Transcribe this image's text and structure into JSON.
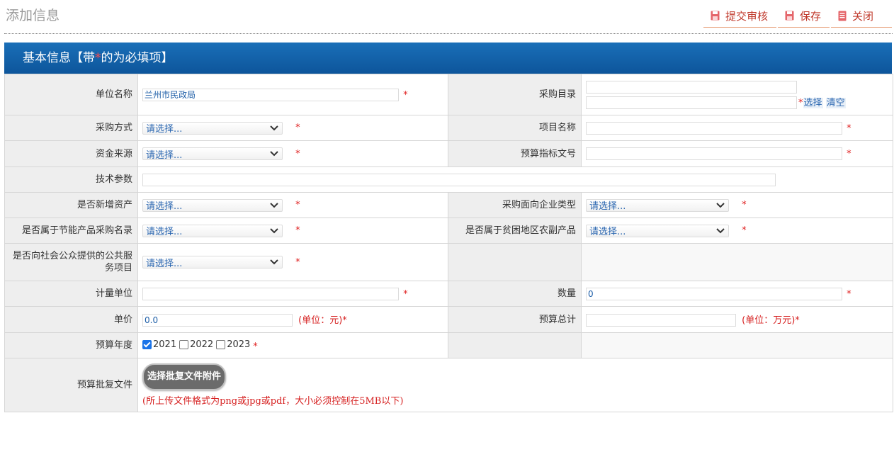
{
  "page": {
    "title": "添加信息"
  },
  "toolbar": {
    "submit_label": "提交审核",
    "save_label": "保存",
    "close_label": "关闭",
    "accent_color": "#c0392b"
  },
  "panel": {
    "title_prefix": "基本信息【带",
    "required_mark": "*",
    "title_suffix": "的为必填项】"
  },
  "form": {
    "unit_name": {
      "label": "单位名称",
      "value": "兰州市民政局",
      "required": "*"
    },
    "purchase_catalog": {
      "label": "采购目录",
      "required": "*",
      "select_link": "选择",
      "clear_link": "清空"
    },
    "purchase_method": {
      "label": "采购方式",
      "selected": "请选择...",
      "required": "*"
    },
    "project_name": {
      "label": "项目名称",
      "value": "",
      "required": "*"
    },
    "fund_source": {
      "label": "资金来源",
      "selected": "请选择...",
      "required": "*"
    },
    "budget_doc_no": {
      "label": "预算指标文号",
      "value": "",
      "required": "*"
    },
    "tech_params": {
      "label": "技术参数",
      "value": ""
    },
    "is_new_asset": {
      "label": "是否新增资产",
      "selected": "请选择...",
      "required": "*"
    },
    "enterprise_type": {
      "label": "采购面向企业类型",
      "selected": "请选择...",
      "required": "*"
    },
    "energy_saving": {
      "label": "是否属于节能产品采购名录",
      "selected": "请选择...",
      "required": "*"
    },
    "poverty_agri": {
      "label": "是否属于贫困地区农副产品",
      "selected": "请选择...",
      "required": "*"
    },
    "public_service": {
      "label": "是否向社会公众提供的公共服务项目",
      "selected": "请选择...",
      "required": "*"
    },
    "measure_unit": {
      "label": "计量单位",
      "value": "",
      "required": "*"
    },
    "quantity": {
      "label": "数量",
      "value": "0",
      "required": "*"
    },
    "unit_price": {
      "label": "单价",
      "value": "0.0",
      "unit": "(单位：元)*"
    },
    "budget_total": {
      "label": "预算总计",
      "value": "",
      "unit": "(单位：万元)*"
    },
    "budget_year": {
      "label": "预算年度",
      "options": [
        {
          "year": "2021",
          "checked": true
        },
        {
          "year": "2022",
          "checked": false
        },
        {
          "year": "2023",
          "checked": false
        }
      ],
      "required": "*"
    },
    "approval_file": {
      "label": "预算批复文件",
      "button": "选择批复文件附件",
      "hint": "(所上传文件格式为png或jpg或pdf，大小必须控制在5MB以下)"
    }
  }
}
